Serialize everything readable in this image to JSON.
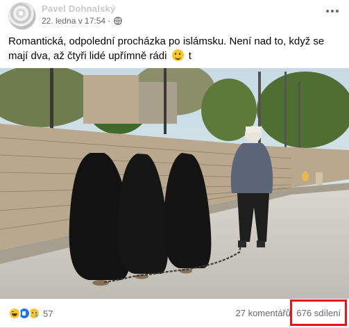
{
  "post": {
    "author": "Pavel Dohnalský",
    "timestamp": "22. ledna v 17:54",
    "dot": "·",
    "caption_text": "Romantická, odpolední procházka po islámsku. Není nad to, když se mají dva, až čtyři lidé upřímně rádi",
    "caption_tail": "t"
  },
  "icons": {
    "privacy": "globe-icon",
    "menu": "more-horizontal-icon",
    "emoji": "smiling-face-icon"
  },
  "footer": {
    "reaction_icons": [
      "haha-reaction-icon",
      "like-reaction-icon",
      "sad-reaction-icon"
    ],
    "reaction_count": "57",
    "comments": "27 komentářů",
    "shares": "676 sdílení"
  },
  "colors": {
    "highlight": "#e8141a",
    "like_blue": "#1877f2",
    "secondary_text": "#65676b"
  }
}
